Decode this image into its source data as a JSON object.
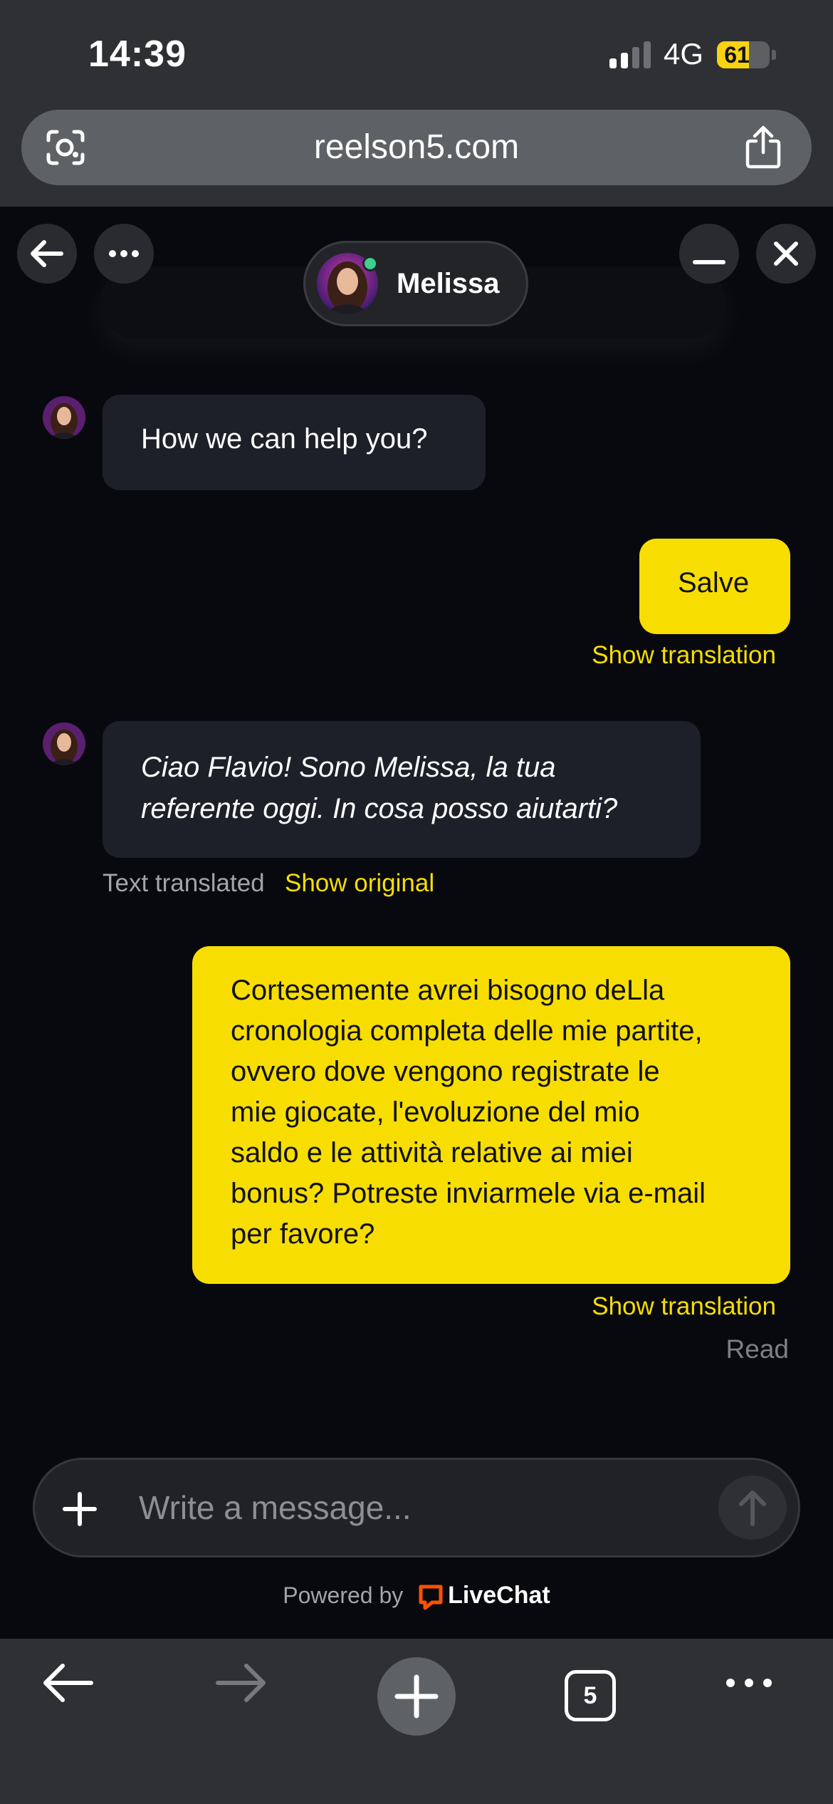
{
  "status_bar": {
    "time": "14:39",
    "network": "4G",
    "battery_level": "61",
    "signal_bars_active": 2,
    "signal_bars_total": 4
  },
  "browser": {
    "url": "reelson5.com"
  },
  "chat_header": {
    "agent_name": "Melissa",
    "agent_status": "online"
  },
  "messages": {
    "agent_1": {
      "text": "How we can help you?"
    },
    "user_1": {
      "text": "Salve",
      "translate_link": "Show translation"
    },
    "agent_2": {
      "text": "Ciao Flavio! Sono Melissa, la tua\nreferente oggi. In cosa posso aiutarti?",
      "meta": "Text translated",
      "toggle_link": "Show original"
    },
    "user_2": {
      "text": "Cortesemente avrei bisogno deLla\ncronologia completa delle mie partite,\novvero dove vengono registrate le\nmie giocate, l'evoluzione del mio\nsaldo e le attività relative ai miei\nbonus? Potreste inviarmele via e-mail\nper favore?",
      "translate_link": "Show translation",
      "status": "Read"
    }
  },
  "composer": {
    "placeholder": "Write a message...",
    "powered_by": "Powered by",
    "brand": "LiveChat"
  },
  "toolbar": {
    "tab_count": "5"
  },
  "colors": {
    "accent": "#f7de00",
    "background": "#08090e",
    "agent_bubble": "#1d2028",
    "chrome": "#2e3034",
    "online": "#3ecf8e",
    "livechat_brand": "#ff5100"
  }
}
